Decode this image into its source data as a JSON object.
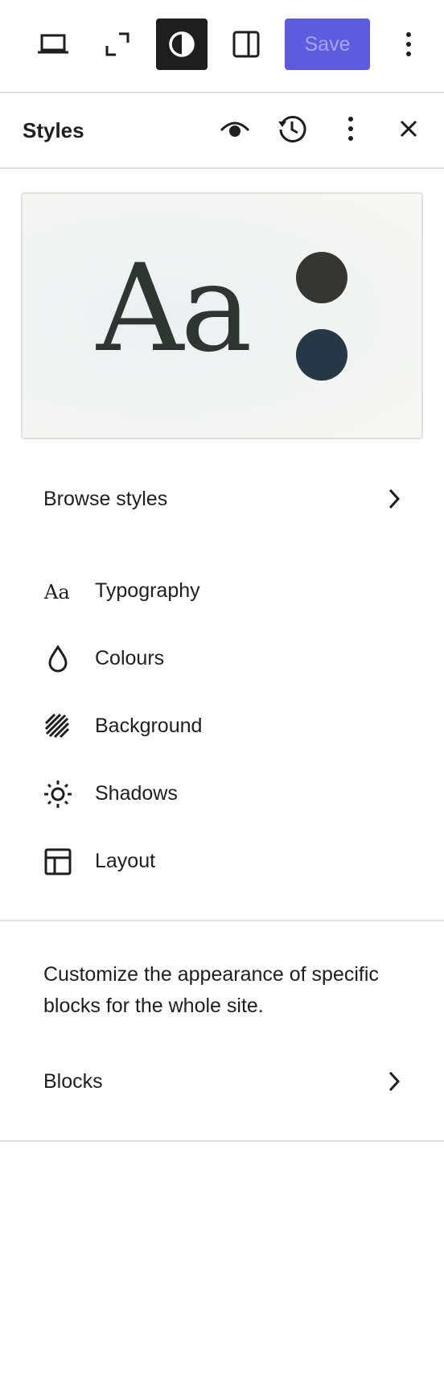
{
  "toolbar": {
    "items": [
      "laptop-icon",
      "fullscreen-icon",
      "contrast-icon",
      "sidebar-icon"
    ],
    "save_label": "Save",
    "options": "vertical-ellipsis-icon",
    "accent_color": "#5d5cde"
  },
  "styles_panel": {
    "title": "Styles",
    "actions": [
      "eye-icon",
      "history-icon",
      "vertical-ellipsis-icon",
      "close-icon"
    ]
  },
  "preview": {
    "sample_text": "Aa",
    "palette": [
      "#353632",
      "#263746"
    ]
  },
  "browse": {
    "label": "Browse styles"
  },
  "tools": [
    {
      "label": "Typography",
      "icon": "typography-icon"
    },
    {
      "label": "Colours",
      "icon": "droplet-icon"
    },
    {
      "label": "Background",
      "icon": "background-icon"
    },
    {
      "label": "Shadows",
      "icon": "sun-icon"
    },
    {
      "label": "Layout",
      "icon": "layout-icon"
    }
  ],
  "blocks_section": {
    "description": "Customize the appearance of specific blocks for the whole site.",
    "label": "Blocks"
  }
}
